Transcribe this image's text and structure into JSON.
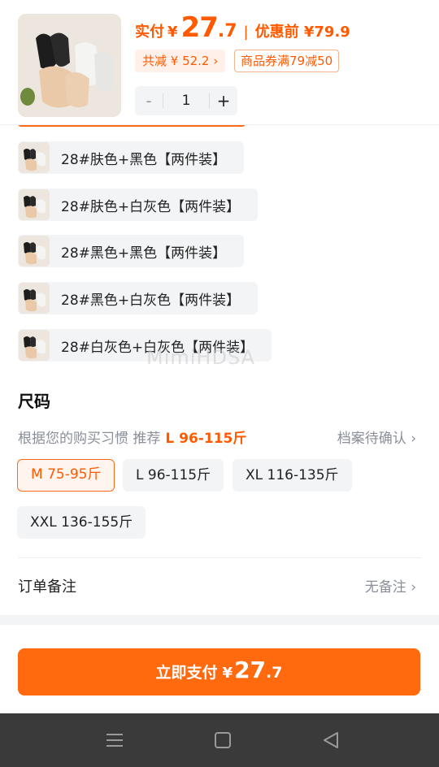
{
  "header": {
    "paid_label": "实付",
    "currency": "¥",
    "price_int": "27",
    "price_dec": ".7",
    "separator": "|",
    "before_label": "优惠前 ¥79.9",
    "discount_chip": "共减 ¥ 52.2 ›",
    "coupon_chip": "商品券满79减50",
    "quantity": {
      "minus": "-",
      "value": "1",
      "plus": "+"
    }
  },
  "options": [
    {
      "label": "28#肤色+黑色【两件装】"
    },
    {
      "label": "28#肤色+白灰色【两件装】"
    },
    {
      "label": "28#黑色+黑色【两件装】"
    },
    {
      "label": "28#黑色+白灰色【两件装】"
    },
    {
      "label": "28#白灰色+白灰色【两件装】"
    }
  ],
  "watermark": "MimiHDSA",
  "size_section": {
    "title": "尺码",
    "recommend_prefix": "根据您的购买习惯 推荐",
    "recommend_size": "L 96-115斤",
    "archive_link": "档案待确认 ›",
    "sizes": [
      "M 75-95斤",
      "L 96-115斤",
      "XL 116-135斤",
      "XXL 136-155斤"
    ],
    "selected_index": 0
  },
  "remark": {
    "label": "订单备注",
    "value": "无备注 ›"
  },
  "pay_button": {
    "label": "立即支付",
    "currency": "¥",
    "price_int": "27",
    "price_dec": ".7"
  },
  "colors": {
    "accent": "#ff6a0f",
    "chip_bg": "#f3f4f6",
    "navbar": "#3b3a3a"
  },
  "icons": [
    "menu-icon",
    "home-square-icon",
    "back-triangle-icon"
  ]
}
